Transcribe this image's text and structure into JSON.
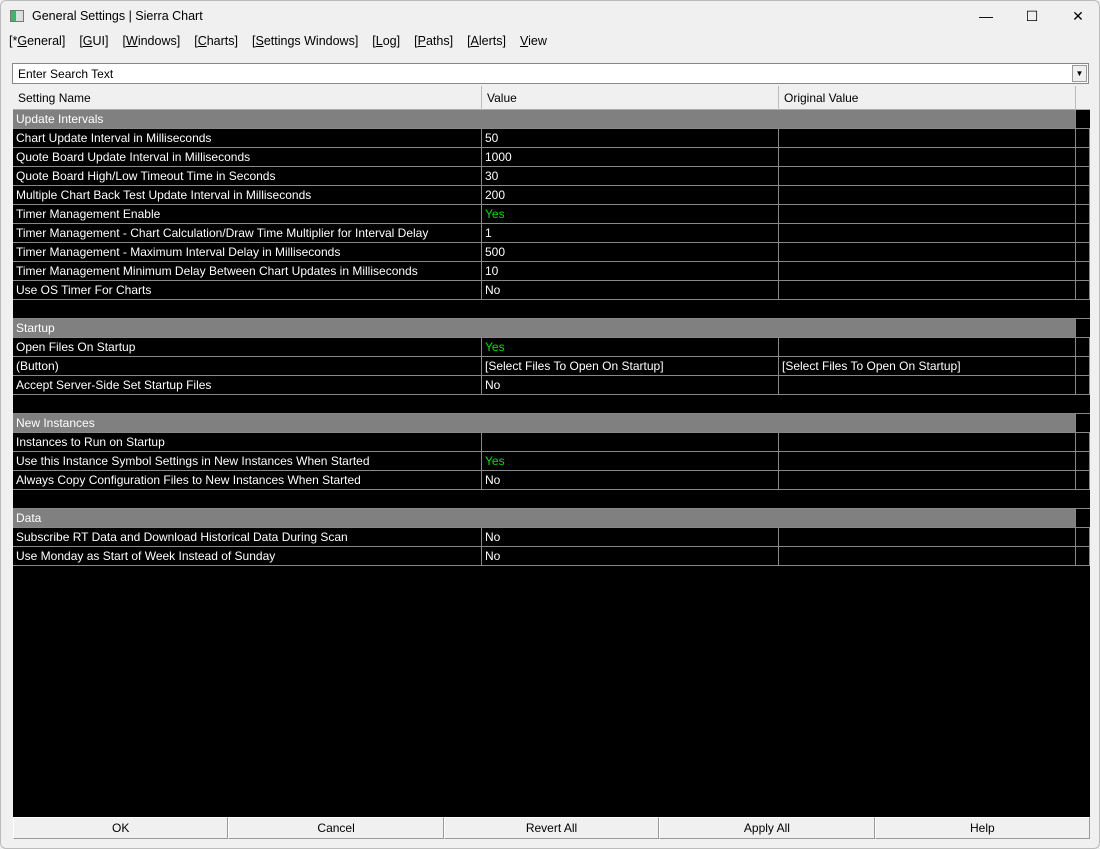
{
  "window": {
    "title": "General Settings | Sierra Chart",
    "minimize": "—",
    "maximize": "☐",
    "close": "✕"
  },
  "menu": [
    {
      "pre": "[*",
      "key": "G",
      "post": "eneral]"
    },
    {
      "pre": "[",
      "key": "G",
      "post": "UI]"
    },
    {
      "pre": "[",
      "key": "W",
      "post": "indows]"
    },
    {
      "pre": "[",
      "key": "C",
      "post": "harts]"
    },
    {
      "pre": "[",
      "key": "S",
      "post": "ettings Windows]"
    },
    {
      "pre": "[",
      "key": "L",
      "post": "og]"
    },
    {
      "pre": "[",
      "key": "P",
      "post": "aths]"
    },
    {
      "pre": "[",
      "key": "A",
      "post": "lerts]"
    },
    {
      "pre": "",
      "key": "V",
      "post": "iew"
    }
  ],
  "search": {
    "placeholder": "Enter Search Text"
  },
  "columns": [
    "Setting Name",
    "Value",
    "Original Value"
  ],
  "rows": [
    {
      "type": "group",
      "name": "Update Intervals"
    },
    {
      "name": "Chart Update Interval in Milliseconds",
      "value": "50",
      "original": ""
    },
    {
      "name": "Quote Board Update Interval in Milliseconds",
      "value": "1000",
      "original": ""
    },
    {
      "name": "Quote Board High/Low Timeout Time in Seconds",
      "value": "30",
      "original": ""
    },
    {
      "name": "Multiple Chart Back Test Update Interval in Milliseconds",
      "value": "200",
      "original": ""
    },
    {
      "name": "Timer Management Enable",
      "value": "Yes",
      "original": ""
    },
    {
      "name": "Timer Management - Chart Calculation/Draw Time Multiplier for Interval Delay",
      "value": "1",
      "original": ""
    },
    {
      "name": "Timer Management - Maximum Interval Delay in Milliseconds",
      "value": "500",
      "original": ""
    },
    {
      "name": "Timer Management Minimum Delay Between Chart Updates in Milliseconds",
      "value": "10",
      "original": ""
    },
    {
      "name": "Use OS Timer For Charts",
      "value": "No",
      "original": ""
    },
    {
      "type": "blank"
    },
    {
      "type": "group",
      "name": "Startup"
    },
    {
      "name": "Open Files On Startup",
      "value": "Yes",
      "original": ""
    },
    {
      "type": "button",
      "name": " (Button)",
      "value": "[Select Files To Open On Startup]",
      "original": "[Select Files To Open On Startup]"
    },
    {
      "name": "Accept Server-Side Set Startup Files",
      "value": "No",
      "original": ""
    },
    {
      "type": "blank"
    },
    {
      "type": "group",
      "name": "New Instances"
    },
    {
      "name": "Instances to Run on Startup",
      "value": "",
      "original": ""
    },
    {
      "name": "Use this Instance Symbol Settings in New Instances When Started",
      "value": "Yes",
      "original": ""
    },
    {
      "name": "Always Copy Configuration Files to New Instances When Started",
      "value": "No",
      "original": ""
    },
    {
      "type": "blank"
    },
    {
      "type": "group",
      "name": "Data"
    },
    {
      "name": "Subscribe RT Data and Download Historical Data During Scan",
      "value": "No",
      "original": ""
    },
    {
      "name": "Use Monday as Start of Week Instead of Sunday",
      "value": "No",
      "original": ""
    }
  ],
  "buttons": [
    "OK",
    "Cancel",
    "Revert All",
    "Apply All",
    "Help"
  ],
  "colors": {
    "yes": "#00e000",
    "group": "#808080"
  }
}
